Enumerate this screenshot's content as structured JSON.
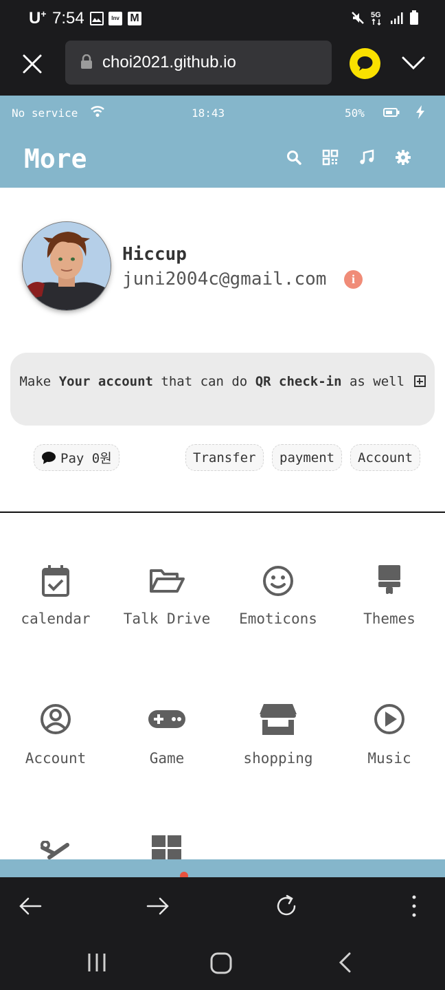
{
  "system_status": {
    "carrier": "U",
    "carrier_sup": "+",
    "time": "7:54",
    "notif_inv": "Inv",
    "notif_gmail": "M"
  },
  "browser": {
    "url": "choi2021.github.io"
  },
  "page_status": {
    "network": "No service",
    "time": "18:43",
    "battery": "50%"
  },
  "header": {
    "title": "More"
  },
  "profile": {
    "name": "Hiccup",
    "email": "juni2004c@gmail.com",
    "info_icon": "i"
  },
  "banner": {
    "text_1": "Make ",
    "bold_1": "Your account",
    "text_2": " that can do ",
    "bold_2": "QR check-in",
    "text_3": " as well"
  },
  "chips": {
    "pay": "Pay 0원",
    "transfer": "Transfer",
    "payment": "payment",
    "account": "Account"
  },
  "menu": [
    {
      "label": "calendar",
      "icon": "calendar-check-icon"
    },
    {
      "label": "Talk Drive",
      "icon": "folder-open-icon"
    },
    {
      "label": "Emoticons",
      "icon": "smile-icon"
    },
    {
      "label": "Themes",
      "icon": "paint-brush-icon"
    },
    {
      "label": "Account",
      "icon": "user-circle-icon"
    },
    {
      "label": "Game",
      "icon": "gamepad-icon"
    },
    {
      "label": "shopping",
      "icon": "store-icon"
    },
    {
      "label": "Music",
      "icon": "play-circle-icon"
    }
  ],
  "colors": {
    "header_bg": "#85b6cb",
    "info_badge": "#f08c78",
    "kakao_yellow": "#fae100",
    "icon_gray": "#5f5f5f"
  }
}
